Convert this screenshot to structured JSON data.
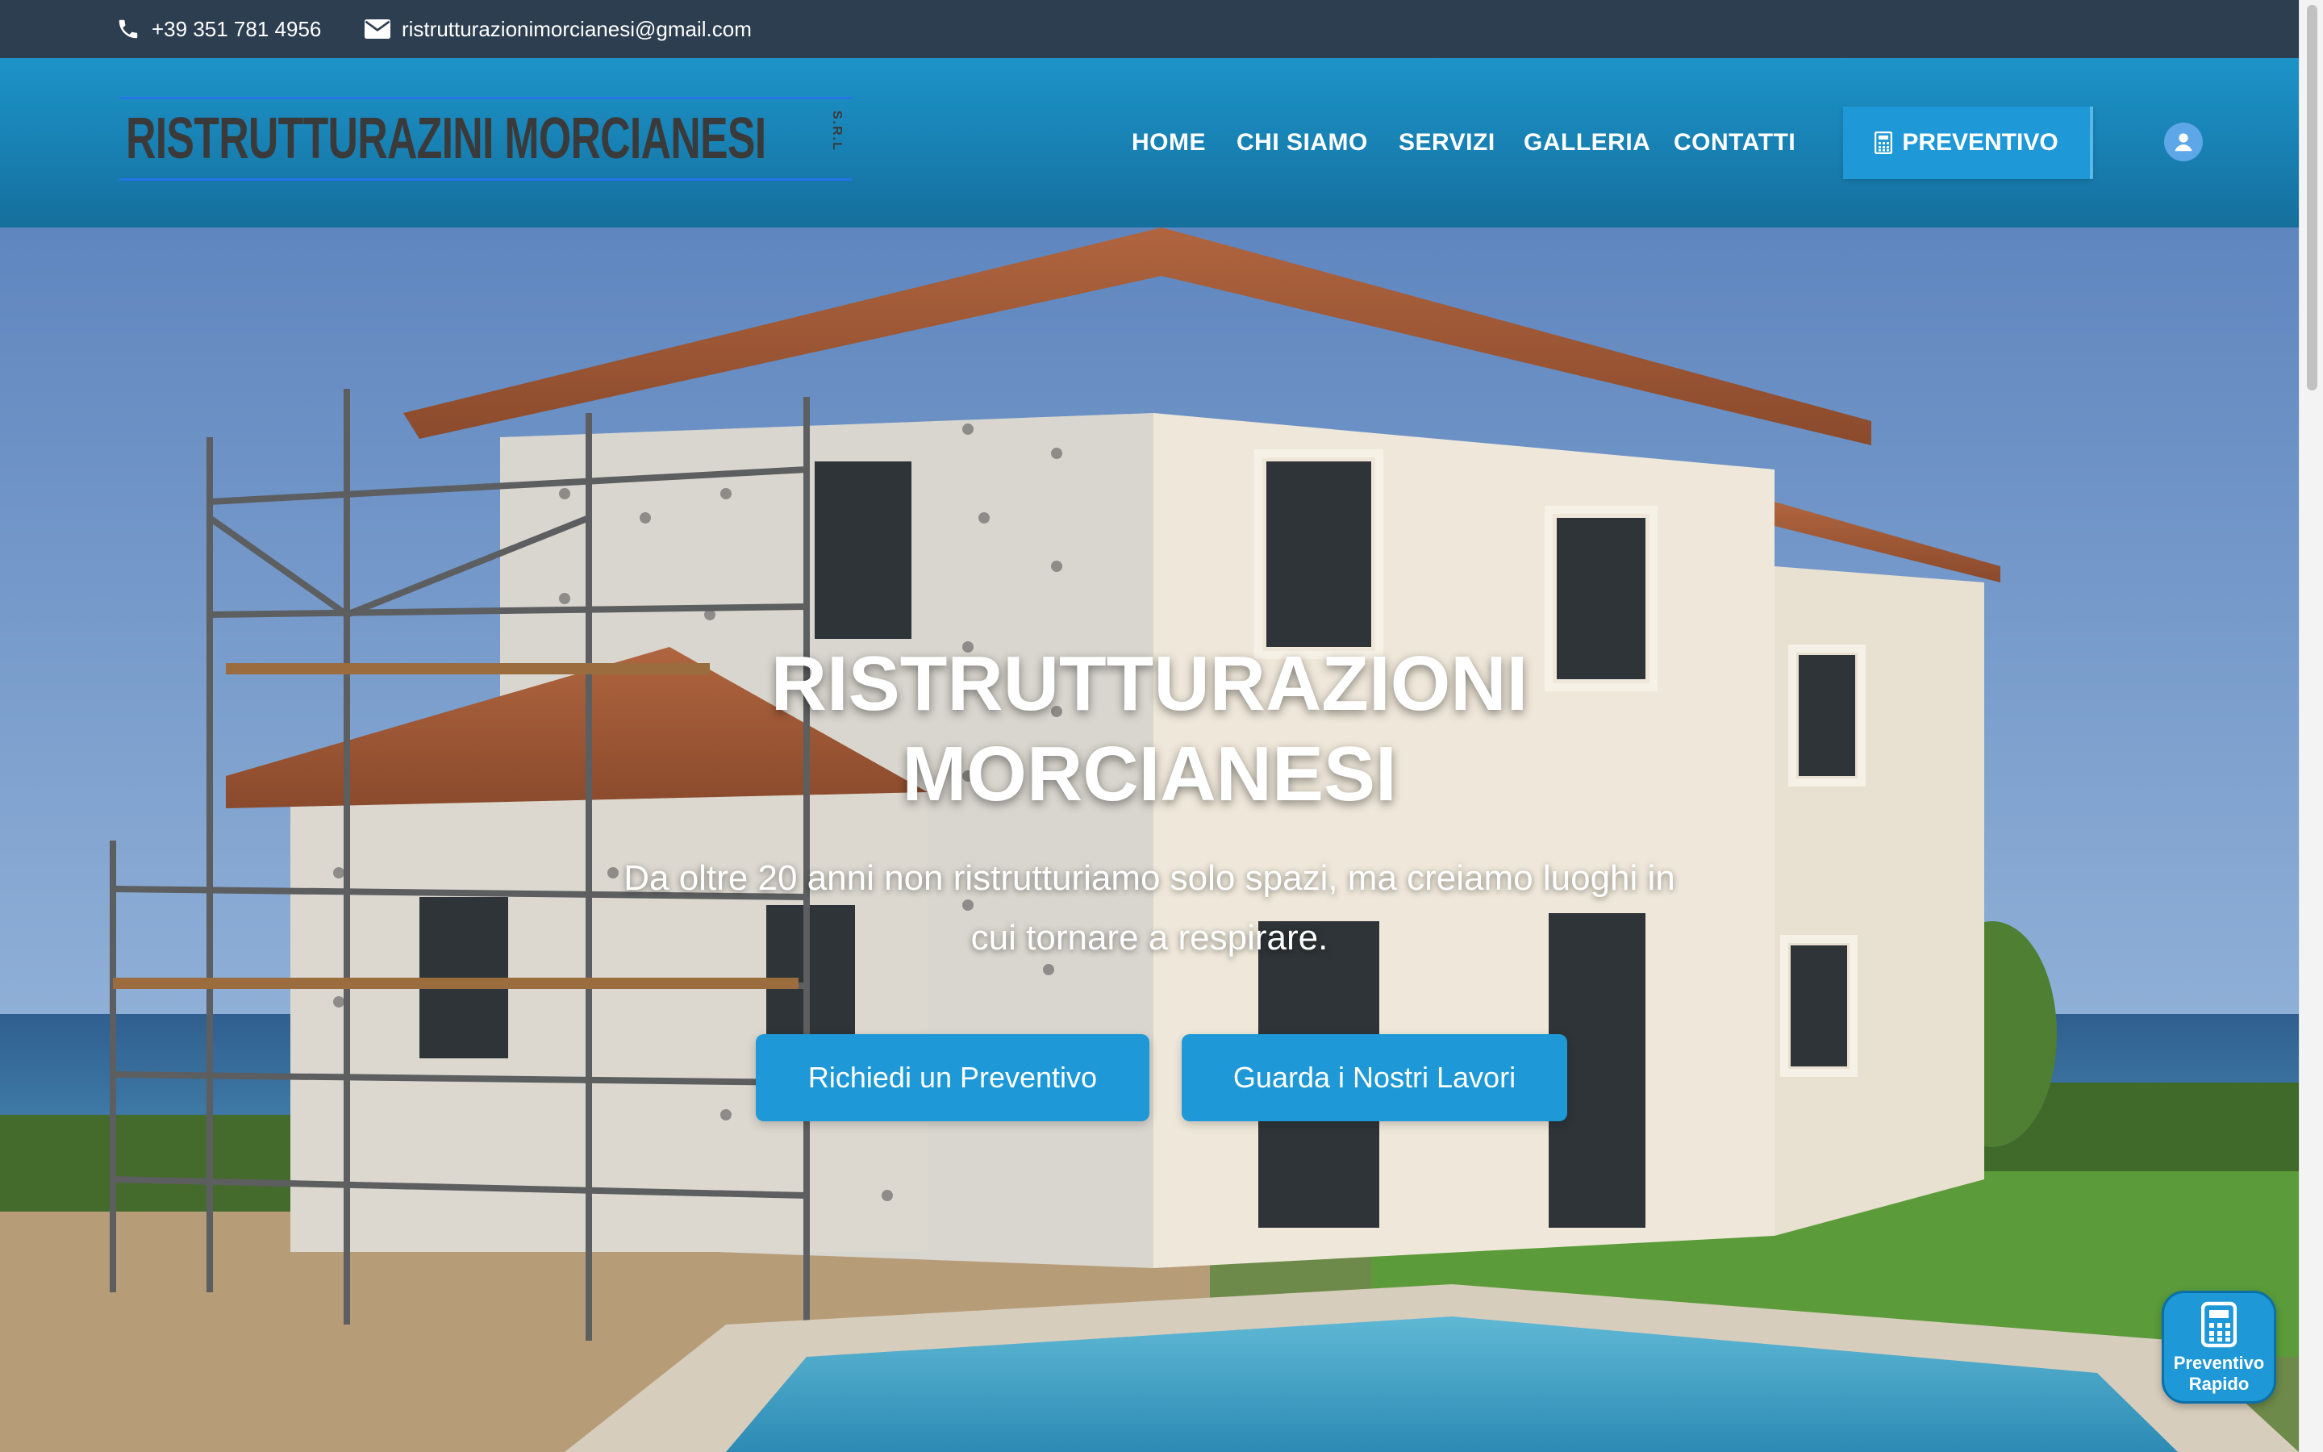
{
  "topbar": {
    "phone": "+39 351 781 4956",
    "email": "ristrutturazionimorcianesi@gmail.com",
    "phone_icon": "phone-icon",
    "email_icon": "envelope-icon"
  },
  "header": {
    "logo_text": "RISTRUTTURAZINI MORCIANESI",
    "logo_srl": "S.R.L",
    "nav": [
      "HOME",
      "CHI SIAMO",
      "SERVIZI",
      "GALLERIA",
      "CONTATTI"
    ],
    "cta_label": "PREVENTIVO",
    "cta_icon": "calculator-icon",
    "user_icon": "user-circle-icon"
  },
  "hero": {
    "title_line1": "RISTRUTTURAZIONI",
    "title_line2": "MORCIANESI",
    "subtitle_line1": "Da oltre 20 anni non ristrutturiamo solo spazi, ma creiamo luoghi in",
    "subtitle_line2": "cui tornare a respirare.",
    "button_primary": "Richiedi un Preventivo",
    "button_secondary": "Guarda i Nostri Lavori"
  },
  "fab": {
    "line1": "Preventivo",
    "line2": "Rapido",
    "icon": "calculator-icon"
  },
  "colors": {
    "topbar": "#2c3e50",
    "header": "#1a8bc0",
    "accent": "#1e98d6"
  }
}
